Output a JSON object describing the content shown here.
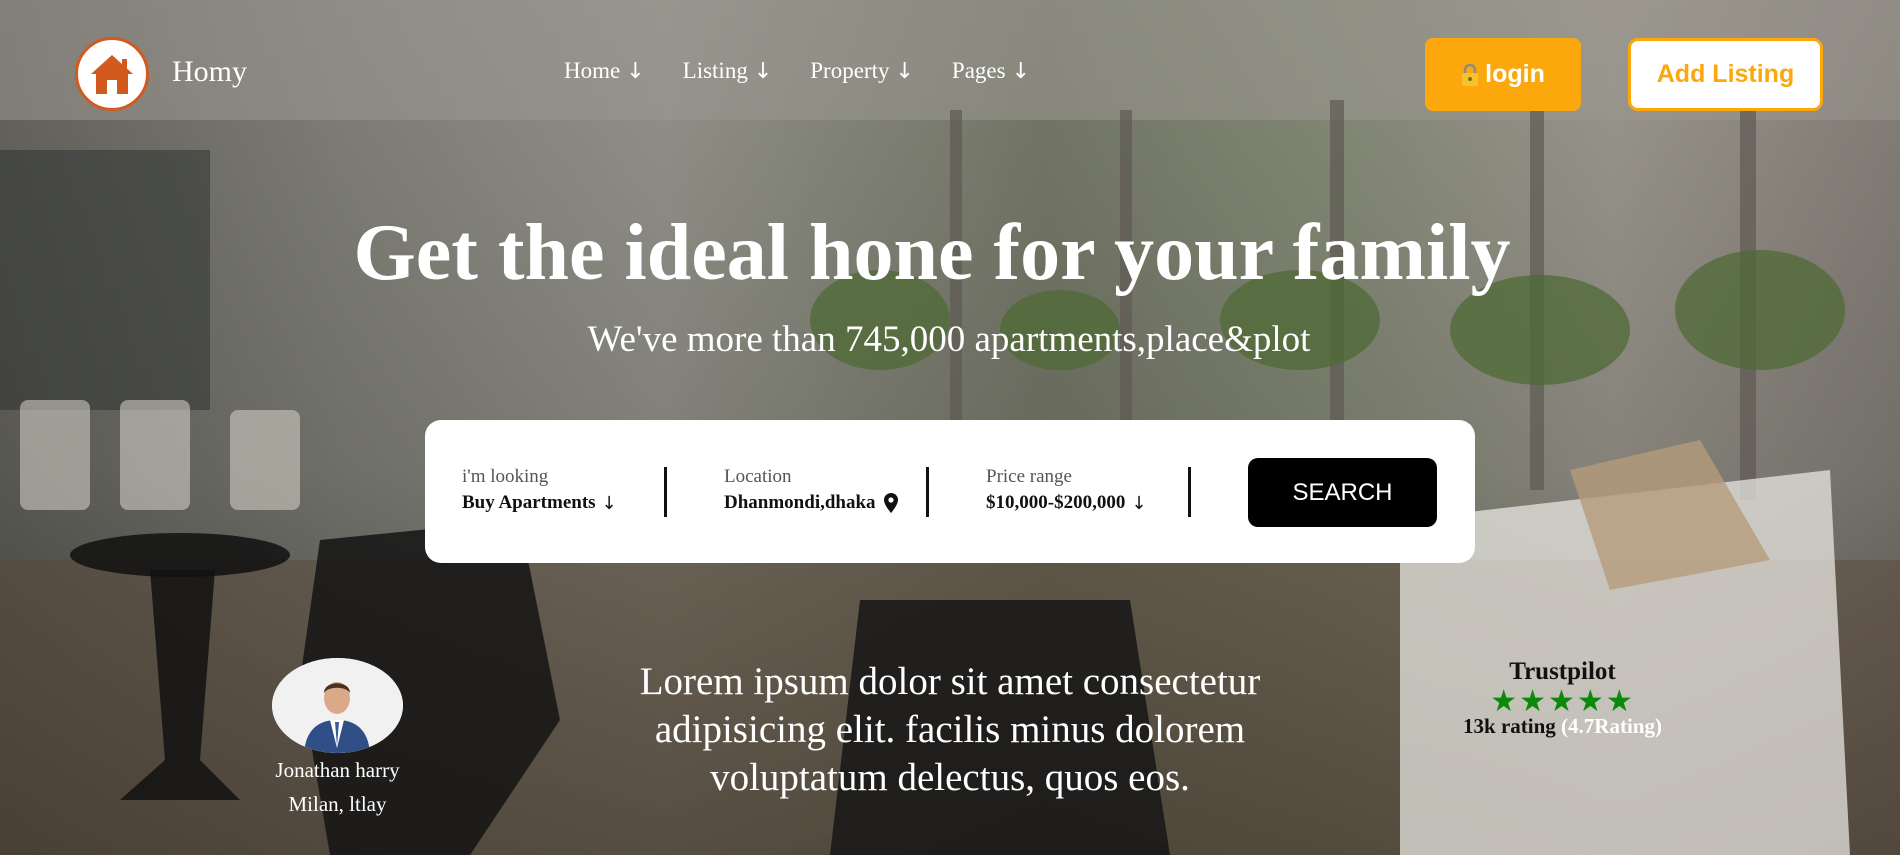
{
  "brand": {
    "name": "Homy",
    "logo_icon": "home-icon"
  },
  "nav": {
    "items": [
      {
        "label": "Home",
        "icon": "arrow-down-icon"
      },
      {
        "label": "Listing",
        "icon": "arrow-down-icon"
      },
      {
        "label": "Property",
        "icon": "arrow-down-icon"
      },
      {
        "label": "Pages",
        "icon": "arrow-down-icon"
      }
    ],
    "arrow_glyph": "↓",
    "login_label": "login",
    "login_icon": "lock-icon",
    "add_listing_label": "Add Listing"
  },
  "hero": {
    "title": "Get the ideal hone for your family",
    "subtitle": "We've more than 745,000 apartments,place&plot"
  },
  "search": {
    "looking": {
      "label": "i'm looking",
      "value": "Buy Apartments"
    },
    "location": {
      "label": "Location",
      "value": "Dhanmondi,dhaka",
      "icon": "location-pin-icon"
    },
    "price": {
      "label": "Price range",
      "value": "$10,000-$200,000"
    },
    "button_label": "SEARCH"
  },
  "testimonial": {
    "name": "Jonathan harry",
    "location": "Milan, ltlay",
    "quote": "Lorem ipsum dolor sit amet consectetur adipisicing elit. facilis minus dolorem voluptatum delectus, quos eos."
  },
  "trustpilot": {
    "title": "Trustpilot",
    "stars": "★★★★★",
    "rating_count": "13k rating",
    "rating_value": "(4.7Rating)"
  },
  "colors": {
    "accent": "#fca80c",
    "logo_orange": "#d25a1e",
    "star_green": "#0a8a0a"
  }
}
